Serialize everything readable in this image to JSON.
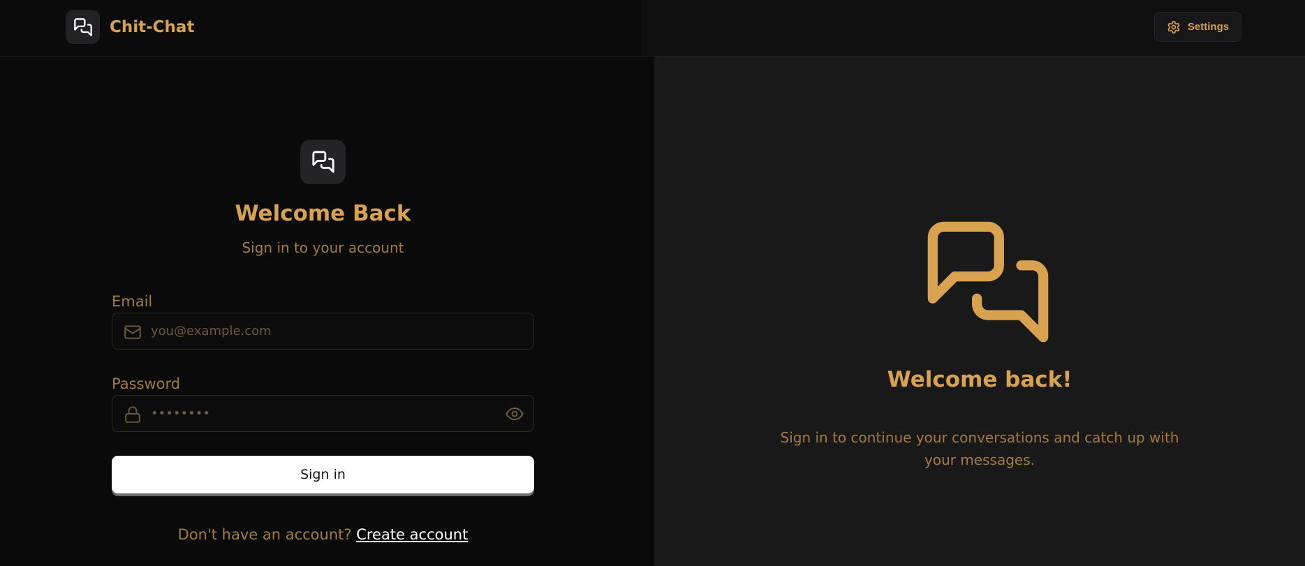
{
  "app": {
    "name": "Chit-Chat"
  },
  "header": {
    "settings_label": "Settings"
  },
  "form": {
    "title": "Welcome Back",
    "subtitle": "Sign in to your account",
    "email_label": "Email",
    "email_placeholder": "you@example.com",
    "password_label": "Password",
    "password_value": "••••••••",
    "signin_label": "Sign in",
    "footer_prompt": "Don't have an account?",
    "create_account_label": "Create account"
  },
  "hero": {
    "title": "Welcome back!",
    "text": "Sign in to continue your conversations and catch up with your messages."
  },
  "colors": {
    "accent": "#d9a24e",
    "muted_accent": "#a47b3f",
    "left_bg": "#0a0a0b",
    "right_bg": "#19191a"
  },
  "icons": {
    "brand": "chat-bubbles-icon",
    "settings": "gear-icon",
    "email": "mail-icon",
    "password": "lock-icon",
    "toggle": "eye-icon"
  }
}
